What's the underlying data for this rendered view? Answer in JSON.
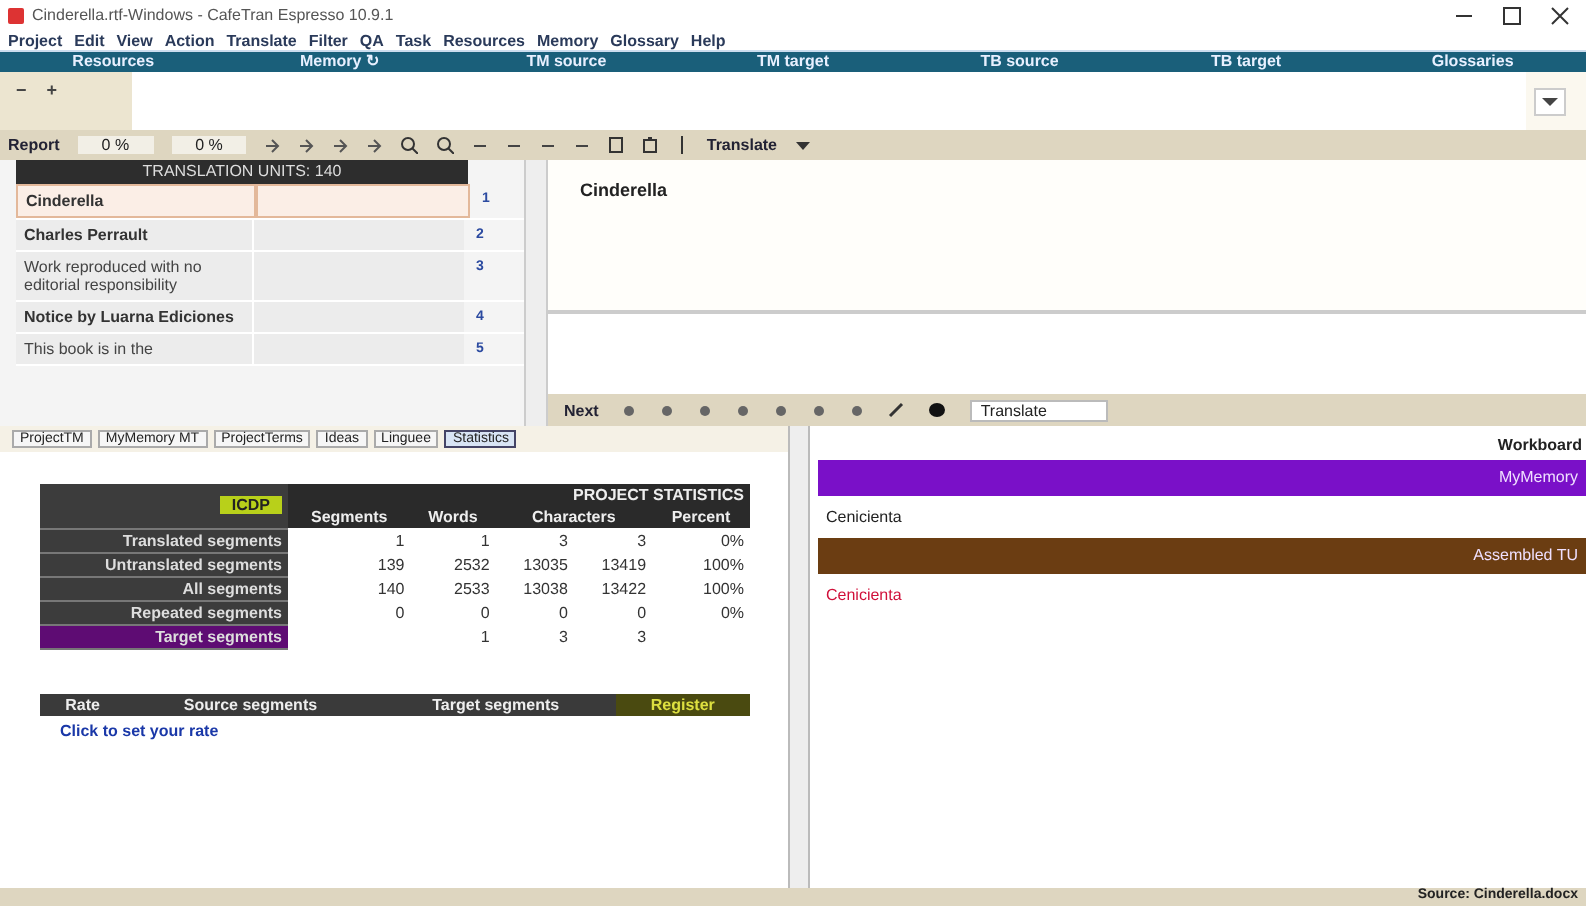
{
  "window": {
    "title": "Cinderella.rtf-Windows - CafeTran Espresso 10.9.1"
  },
  "menu": [
    "Project",
    "Edit",
    "View",
    "Action",
    "Translate",
    "Filter",
    "QA",
    "Task",
    "Resources",
    "Memory",
    "Glossary",
    "Help"
  ],
  "zoom_controls": [
    "−",
    "+"
  ],
  "resource_bar": [
    "Resources",
    "Memory ↻",
    "TM source",
    "TM target",
    "TB source",
    "TB target",
    "Glossaries"
  ],
  "toolbar": {
    "report": "Report",
    "progress_1": "0 %",
    "progress_2": "0 %",
    "mode": "Translate"
  },
  "grid": {
    "title": "TRANSLATION UNITS: 140",
    "rows": [
      {
        "source": "Cinderella",
        "number": "1",
        "selected": true
      },
      {
        "source": "Charles Perrault",
        "number": "2",
        "selected": false,
        "bold": true
      },
      {
        "source": "Work reproduced with no editorial responsibility",
        "number": "3",
        "selected": false,
        "bold": false
      },
      {
        "source": "Notice by Luarna Ediciones",
        "number": "4",
        "selected": false,
        "bold": true
      },
      {
        "source": "This book is in the",
        "number": "5",
        "selected": false,
        "bold": false
      }
    ]
  },
  "editor": {
    "source": "Cinderella",
    "next": "Next",
    "mode": "Translate"
  },
  "tabs": [
    {
      "label": "ProjectTM",
      "selected": false
    },
    {
      "label": "MyMemory MT",
      "selected": false
    },
    {
      "label": "ProjectTerms",
      "selected": false
    },
    {
      "label": "Ideas",
      "selected": false
    },
    {
      "label": "Linguee",
      "selected": false
    },
    {
      "label": "Statistics",
      "selected": true
    }
  ],
  "statistics": {
    "label": "ICDP",
    "title": "PROJECT STATISTICS",
    "columns": [
      "Segments",
      "Words",
      "Characters",
      "Percent"
    ],
    "rows": [
      {
        "label": "Translated segments",
        "values": {
          "segments": "1",
          "words": "1",
          "characters_1": "3",
          "characters_2": "3",
          "percent": "0%"
        },
        "highlight": false
      },
      {
        "label": "Untranslated segments",
        "values": {
          "segments": "139",
          "words": "2532",
          "characters_1": "13035",
          "characters_2": "13419",
          "percent": "100%"
        },
        "highlight": false
      },
      {
        "label": "All segments",
        "values": {
          "segments": "140",
          "words": "2533",
          "characters_1": "13038",
          "characters_2": "13422",
          "percent": "100%"
        },
        "highlight": false
      },
      {
        "label": "Repeated segments",
        "values": {
          "segments": "0",
          "words": "0",
          "characters_1": "0",
          "characters_2": "0",
          "percent": "0%"
        },
        "highlight": false
      },
      {
        "label": "Target segments",
        "values": {
          "words": "1",
          "characters_1": "3",
          "characters_2": "3"
        },
        "highlight": true
      }
    ],
    "rate_columns": [
      "Rate",
      "Source segments",
      "Target segments",
      "Register"
    ],
    "rate_link": "Click to set your rate"
  },
  "workboard": {
    "title": "Workboard",
    "entries": [
      {
        "header": "MyMemory",
        "text": "Cenicienta",
        "color": "#7a10c8",
        "kind": "memory"
      },
      {
        "header": "Assembled TU",
        "text": "Cenicienta",
        "color": "#6b3d12",
        "kind": "assembled"
      }
    ]
  },
  "status_bar": "Source: Cinderella.docx"
}
